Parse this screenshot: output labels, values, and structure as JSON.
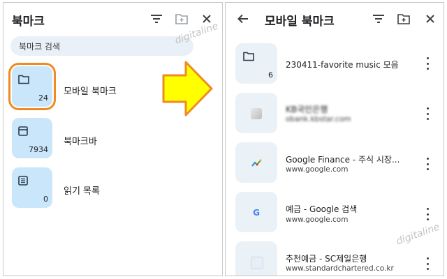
{
  "left_panel": {
    "title": "북마크",
    "search_placeholder": "북마크 검색",
    "folders": [
      {
        "label": "모바일 북마크",
        "count": "24",
        "icon": "folder-icon",
        "selected": true
      },
      {
        "label": "북마크바",
        "count": "7934",
        "icon": "bookmark-bar-icon"
      },
      {
        "label": "읽기 목록",
        "count": "0",
        "icon": "reading-list-icon"
      }
    ],
    "icons": [
      "filter-icon",
      "new-folder-icon",
      "close-icon"
    ]
  },
  "right_panel": {
    "title": "모바일 북마크",
    "icons": [
      "back-arrow-icon",
      "filter-icon",
      "new-folder-icon",
      "close-icon"
    ],
    "items": [
      {
        "title": "230411-favorite music 모음",
        "count": "6",
        "type": "folder"
      },
      {
        "title": "KB국민은행",
        "url": "obank.kbstar.com",
        "favicon": "kb-bank-icon"
      },
      {
        "title": "Google Finance - 주식 시장...",
        "url": "www.google.com",
        "favicon": "google-finance-icon"
      },
      {
        "title": "예금 - Google 검색",
        "url": "www.google.com",
        "favicon": "google-g-icon"
      },
      {
        "title": "추천예금 - SC제일은행",
        "url": "www.standardchartered.co.kr",
        "favicon": "sc-bank-icon"
      }
    ]
  },
  "watermark": "digitaline",
  "colors": {
    "accent_orange": "#f08a24",
    "arrow_yellow": "#ffff00",
    "tile_blue": "#c9e6fb",
    "tile_grey": "#eaf1f7"
  }
}
